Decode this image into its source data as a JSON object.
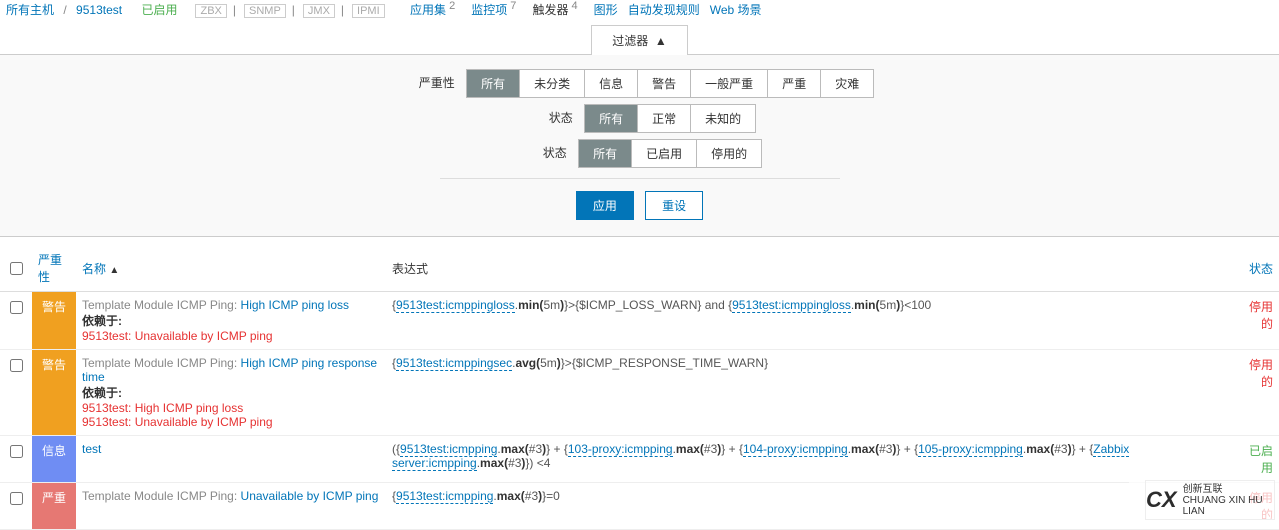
{
  "breadcrumbs": {
    "all_hosts": "所有主机",
    "host": "9513test",
    "status": "已启用",
    "types": [
      "ZBX",
      "SNMP",
      "JMX",
      "IPMI"
    ],
    "tabs": [
      {
        "label": "应用集",
        "count": "2"
      },
      {
        "label": "监控项",
        "count": "7"
      },
      {
        "label": "触发器",
        "count": "4",
        "active": true
      },
      {
        "label": "图形",
        "count": ""
      },
      {
        "label": "自动发现规则",
        "count": ""
      },
      {
        "label": "Web 场景",
        "count": ""
      }
    ]
  },
  "filter": {
    "tab_label": "过滤器",
    "severity_label": "严重性",
    "severity_opts": [
      "所有",
      "未分类",
      "信息",
      "警告",
      "一般严重",
      "严重",
      "灾难"
    ],
    "state_label": "状态",
    "state_opts": [
      "所有",
      "正常",
      "未知的"
    ],
    "status_label": "状态",
    "status_opts": [
      "所有",
      "已启用",
      "停用的"
    ],
    "apply": "应用",
    "reset": "重设"
  },
  "table": {
    "headers": {
      "severity": "严重性",
      "name": "名称",
      "expression": "表达式",
      "status": "状态"
    }
  },
  "rows": [
    {
      "severity": "警告",
      "sev_class": "sev-warning",
      "template": "Template Module ICMP Ping",
      "name": "High ICMP ping loss",
      "deps_label": "依赖于:",
      "deps": [
        "9513test: Unavailable by ICMP ping"
      ],
      "expr_parts": [
        {
          "t": "plain",
          "v": "{"
        },
        {
          "t": "link",
          "v": "9513test:icmppingloss"
        },
        {
          "t": "plain",
          "v": "."
        },
        {
          "t": "bold",
          "v": "min("
        },
        {
          "t": "plain",
          "v": "5m"
        },
        {
          "t": "bold",
          "v": ")"
        },
        {
          "t": "plain",
          "v": "}>{$ICMP_LOSS_WARN} and {"
        },
        {
          "t": "link",
          "v": "9513test:icmppingloss"
        },
        {
          "t": "plain",
          "v": "."
        },
        {
          "t": "bold",
          "v": "min("
        },
        {
          "t": "plain",
          "v": "5m"
        },
        {
          "t": "bold",
          "v": ")"
        },
        {
          "t": "plain",
          "v": "}<100"
        }
      ],
      "status": "停用的",
      "status_class": "red-link"
    },
    {
      "severity": "警告",
      "sev_class": "sev-warning",
      "template": "Template Module ICMP Ping",
      "name": "High ICMP ping response time",
      "deps_label": "依赖于:",
      "deps": [
        "9513test: High ICMP ping loss",
        "9513test: Unavailable by ICMP ping"
      ],
      "expr_parts": [
        {
          "t": "plain",
          "v": "{"
        },
        {
          "t": "link",
          "v": "9513test:icmppingsec"
        },
        {
          "t": "plain",
          "v": "."
        },
        {
          "t": "bold",
          "v": "avg("
        },
        {
          "t": "plain",
          "v": "5m"
        },
        {
          "t": "bold",
          "v": ")"
        },
        {
          "t": "plain",
          "v": "}>{$ICMP_RESPONSE_TIME_WARN}"
        }
      ],
      "status": "停用的",
      "status_class": "red-link"
    },
    {
      "severity": "信息",
      "sev_class": "sev-info",
      "template": "",
      "name": "test",
      "deps_label": "",
      "deps": [],
      "expr_parts": [
        {
          "t": "plain",
          "v": "({"
        },
        {
          "t": "link",
          "v": "9513test:icmpping"
        },
        {
          "t": "plain",
          "v": "."
        },
        {
          "t": "bold",
          "v": "max("
        },
        {
          "t": "plain",
          "v": "#3"
        },
        {
          "t": "bold",
          "v": ")"
        },
        {
          "t": "plain",
          "v": "} + {"
        },
        {
          "t": "link",
          "v": "103-proxy:icmpping"
        },
        {
          "t": "plain",
          "v": "."
        },
        {
          "t": "bold",
          "v": "max("
        },
        {
          "t": "plain",
          "v": "#3"
        },
        {
          "t": "bold",
          "v": ")"
        },
        {
          "t": "plain",
          "v": "} + {"
        },
        {
          "t": "link",
          "v": "104-proxy:icmpping"
        },
        {
          "t": "plain",
          "v": "."
        },
        {
          "t": "bold",
          "v": "max("
        },
        {
          "t": "plain",
          "v": "#3"
        },
        {
          "t": "bold",
          "v": ")"
        },
        {
          "t": "plain",
          "v": "} + {"
        },
        {
          "t": "link",
          "v": "105-proxy:icmpping"
        },
        {
          "t": "plain",
          "v": "."
        },
        {
          "t": "bold",
          "v": "max("
        },
        {
          "t": "plain",
          "v": "#3"
        },
        {
          "t": "bold",
          "v": ")"
        },
        {
          "t": "plain",
          "v": "} + {"
        },
        {
          "t": "link",
          "v": "Zabbix server:icmpping"
        },
        {
          "t": "plain",
          "v": "."
        },
        {
          "t": "bold",
          "v": "max("
        },
        {
          "t": "plain",
          "v": "#3"
        },
        {
          "t": "bold",
          "v": ")"
        },
        {
          "t": "plain",
          "v": "}) <4"
        }
      ],
      "status": "已启用",
      "status_class": "green"
    },
    {
      "severity": "严重",
      "sev_class": "sev-high",
      "template": "Template Module ICMP Ping",
      "name": "Unavailable by ICMP ping",
      "deps_label": "",
      "deps": [],
      "expr_parts": [
        {
          "t": "plain",
          "v": "{"
        },
        {
          "t": "link",
          "v": "9513test:icmpping"
        },
        {
          "t": "plain",
          "v": "."
        },
        {
          "t": "bold",
          "v": "max("
        },
        {
          "t": "plain",
          "v": "#3"
        },
        {
          "t": "bold",
          "v": ")"
        },
        {
          "t": "plain",
          "v": "}=0"
        }
      ],
      "status": "停用的",
      "status_class": "red-link"
    }
  ],
  "watermark": {
    "logo": "CX",
    "line1": "创新互联",
    "line2": "CHUANG XIN HU LIAN"
  }
}
